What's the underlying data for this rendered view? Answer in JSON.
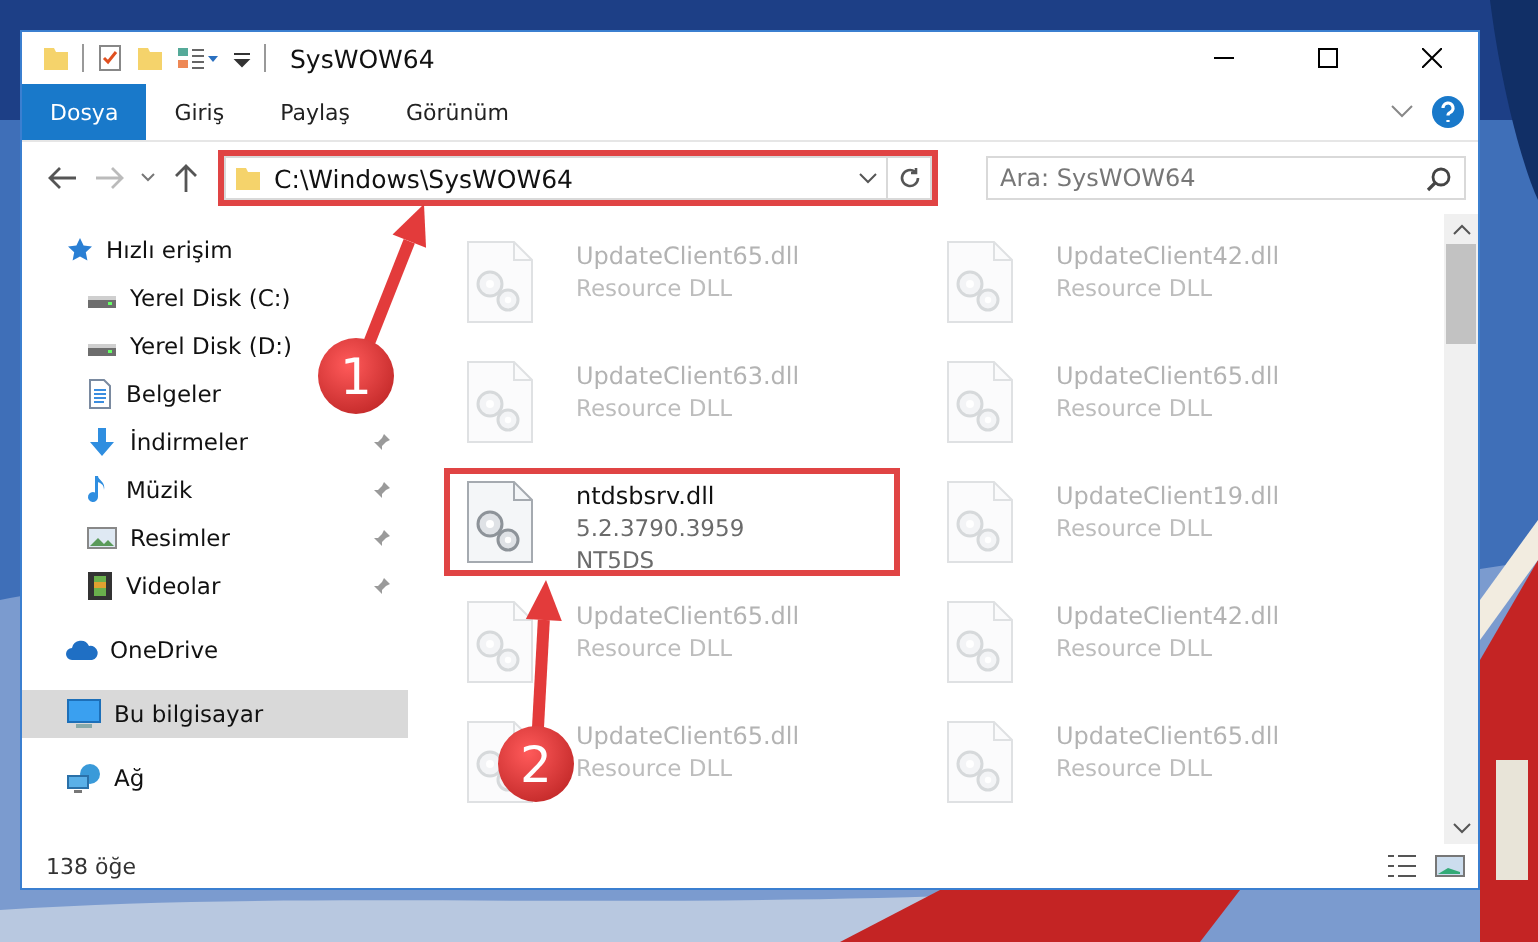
{
  "window": {
    "title": "SysWOW64"
  },
  "ribbon": {
    "tabs": [
      {
        "label": "Dosya",
        "selected": true
      },
      {
        "label": "Giriş",
        "selected": false
      },
      {
        "label": "Paylaş",
        "selected": false
      },
      {
        "label": "Görünüm",
        "selected": false
      }
    ]
  },
  "address_bar": {
    "path": "C:\\Windows\\SysWOW64",
    "highlighted": true
  },
  "search": {
    "placeholder": "Ara: SysWOW64"
  },
  "sidebar": {
    "items": [
      {
        "label": "Hızlı erişim",
        "kind": "quick",
        "selected": false,
        "children": [
          {
            "label": "Yerel Disk (C:)",
            "kind": "drive",
            "selected": false,
            "pinned": false
          },
          {
            "label": "Yerel Disk (D:)",
            "kind": "drive",
            "selected": false,
            "pinned": false
          },
          {
            "label": "Belgeler",
            "kind": "documents",
            "selected": false,
            "pinned": false
          },
          {
            "label": "İndirmeler",
            "kind": "downloads",
            "selected": false,
            "pinned": true
          },
          {
            "label": "Müzik",
            "kind": "music",
            "selected": false,
            "pinned": true
          },
          {
            "label": "Resimler",
            "kind": "pictures",
            "selected": false,
            "pinned": true
          },
          {
            "label": "Videolar",
            "kind": "videos",
            "selected": false,
            "pinned": true
          }
        ]
      },
      {
        "label": "OneDrive",
        "kind": "cloud",
        "selected": false
      },
      {
        "label": "Bu bilgisayar",
        "kind": "computer",
        "selected": true
      },
      {
        "label": "Ağ",
        "kind": "network",
        "selected": false
      }
    ]
  },
  "files": [
    {
      "name": "UpdateClient65.dll",
      "lines": [
        "Resource DLL"
      ],
      "faded": true,
      "highlighted": false
    },
    {
      "name": "UpdateClient42.dll",
      "lines": [
        "Resource DLL"
      ],
      "faded": true,
      "highlighted": false
    },
    {
      "name": "UpdateClient63.dll",
      "lines": [
        "Resource DLL"
      ],
      "faded": true,
      "highlighted": false
    },
    {
      "name": "UpdateClient65.dll",
      "lines": [
        "Resource DLL"
      ],
      "faded": true,
      "highlighted": false
    },
    {
      "name": "ntdsbsrv.dll",
      "lines": [
        "5.2.3790.3959",
        "NT5DS"
      ],
      "faded": false,
      "highlighted": true
    },
    {
      "name": "UpdateClient19.dll",
      "lines": [
        "Resource DLL"
      ],
      "faded": true,
      "highlighted": false
    },
    {
      "name": "UpdateClient65.dll",
      "lines": [
        "Resource DLL"
      ],
      "faded": true,
      "highlighted": false
    },
    {
      "name": "UpdateClient42.dll",
      "lines": [
        "Resource DLL"
      ],
      "faded": true,
      "highlighted": false
    },
    {
      "name": "UpdateClient65.dll",
      "lines": [
        "Resource DLL"
      ],
      "faded": true,
      "highlighted": false
    },
    {
      "name": "UpdateClient65.dll",
      "lines": [
        "Resource DLL"
      ],
      "faded": true,
      "highlighted": false
    }
  ],
  "status_bar": {
    "count": "138 öğe"
  },
  "annotations": [
    {
      "number": "1"
    },
    {
      "number": "2"
    }
  ]
}
